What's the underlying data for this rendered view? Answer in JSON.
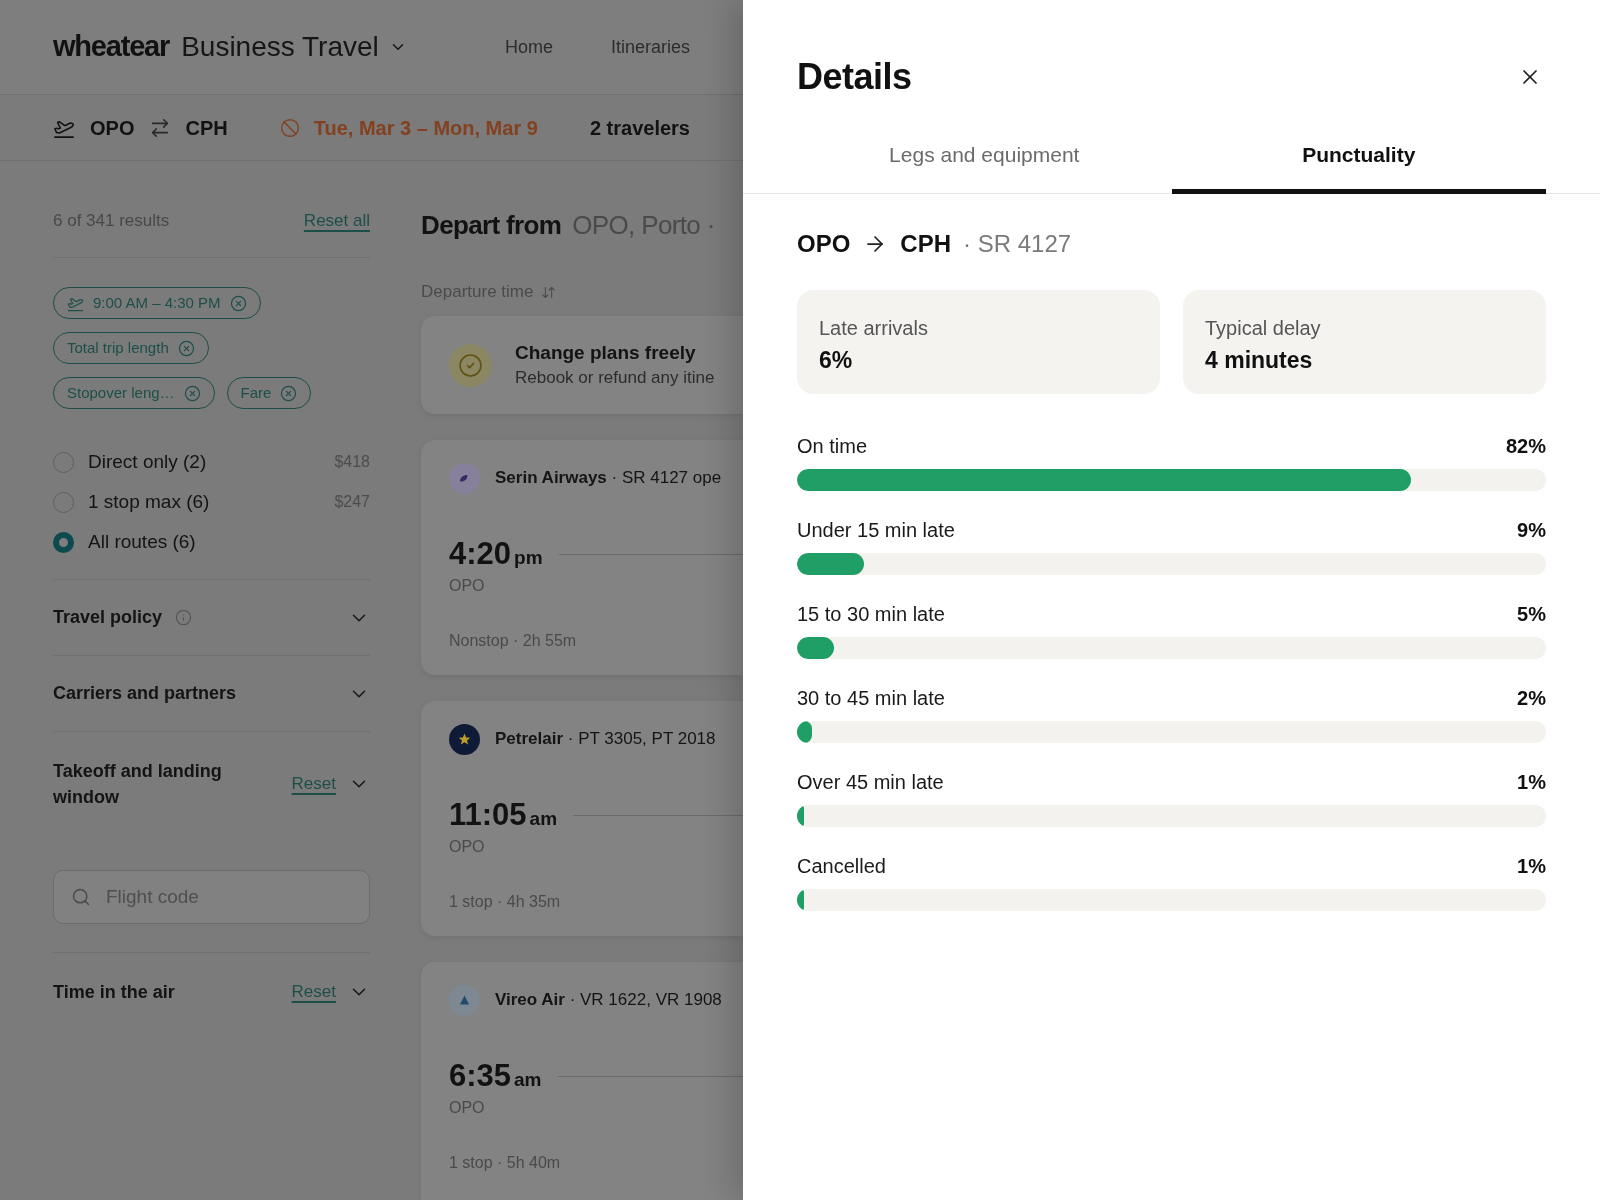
{
  "header": {
    "logo": "wheatear",
    "product": "Business Travel",
    "nav": [
      "Home",
      "Itineraries"
    ]
  },
  "trip": {
    "origin": "OPO",
    "destination": "CPH",
    "dates": "Tue, Mar 3 – Mon, Mar 9",
    "travelers": "2 travelers"
  },
  "filters": {
    "results": "6 of 341 results",
    "reset_all": "Reset all",
    "chips": [
      {
        "kind": "time",
        "label": "9:00 AM – 4:30 PM"
      },
      {
        "kind": "plain",
        "label": "Total trip length"
      },
      {
        "kind": "plain",
        "label": "Stopover leng…"
      },
      {
        "kind": "plain",
        "label": "Fare"
      }
    ],
    "stops": [
      {
        "label": "Direct only (2)",
        "price": "$418",
        "selected": false
      },
      {
        "label": "1 stop max (6)",
        "price": "$247",
        "selected": false
      },
      {
        "label": "All routes (6)",
        "selected": true
      }
    ],
    "sections": [
      {
        "kind": "info",
        "title": "Travel policy"
      },
      {
        "kind": "plain",
        "title": "Carriers and partners"
      },
      {
        "kind": "reset",
        "title": "Takeoff and landing window",
        "reset": "Reset"
      },
      {
        "kind": "search",
        "placeholder": "Flight code"
      },
      {
        "kind": "reset",
        "title": "Time in the air",
        "reset": "Reset"
      }
    ]
  },
  "results": {
    "heading": "Depart from",
    "location": "OPO, Porto ·",
    "sort": "Departure time",
    "promo": {
      "title": "Change plans freely",
      "text": "Rebook or refund any itine"
    },
    "flights": [
      {
        "kind": "crescent",
        "airline": "**Serin Airways** · SR 4127 ope",
        "time": "4:20",
        "period": "pm",
        "airport": "OPO",
        "summary": "Nonstop · 2h 55m"
      },
      {
        "kind": "star",
        "airline": "**Petrelair** · PT 3305, PT 2018",
        "time": "11:05",
        "period": "am",
        "airport": "OPO",
        "summary": "1 stop · 4h 35m"
      },
      {
        "kind": "triangle",
        "airline": "**Vireo Air** · VR 1622, VR 1908",
        "time": "6:35",
        "period": "am",
        "airport": "OPO",
        "summary": "1 stop · 5h 40m"
      }
    ]
  },
  "details": {
    "title": "Details",
    "tabs": [
      {
        "label": "Legs and equipment",
        "selected": false
      },
      {
        "label": "Punctuality",
        "selected": true
      }
    ],
    "route": {
      "origin": "OPO",
      "destination": "CPH",
      "flight": "· SR 4127"
    },
    "stats": [
      {
        "label": "Late arrivals",
        "value": "6%"
      },
      {
        "label": "Typical delay",
        "value": "4 minutes"
      }
    ],
    "punctuality": [
      {
        "label": "On time",
        "reading": "82%",
        "level": 0.82
      },
      {
        "label": "Under 15 min late",
        "reading": "9%",
        "level": 0.09
      },
      {
        "label": "15 to 30 min late",
        "reading": "5%",
        "level": 0.05
      },
      {
        "label": "30 to 45 min late",
        "reading": "2%",
        "level": 0.02
      },
      {
        "label": "Over 45 min late",
        "reading": "1%",
        "level": 0.01
      },
      {
        "label": "Cancelled",
        "reading": "1%",
        "level": 0.01
      }
    ]
  }
}
